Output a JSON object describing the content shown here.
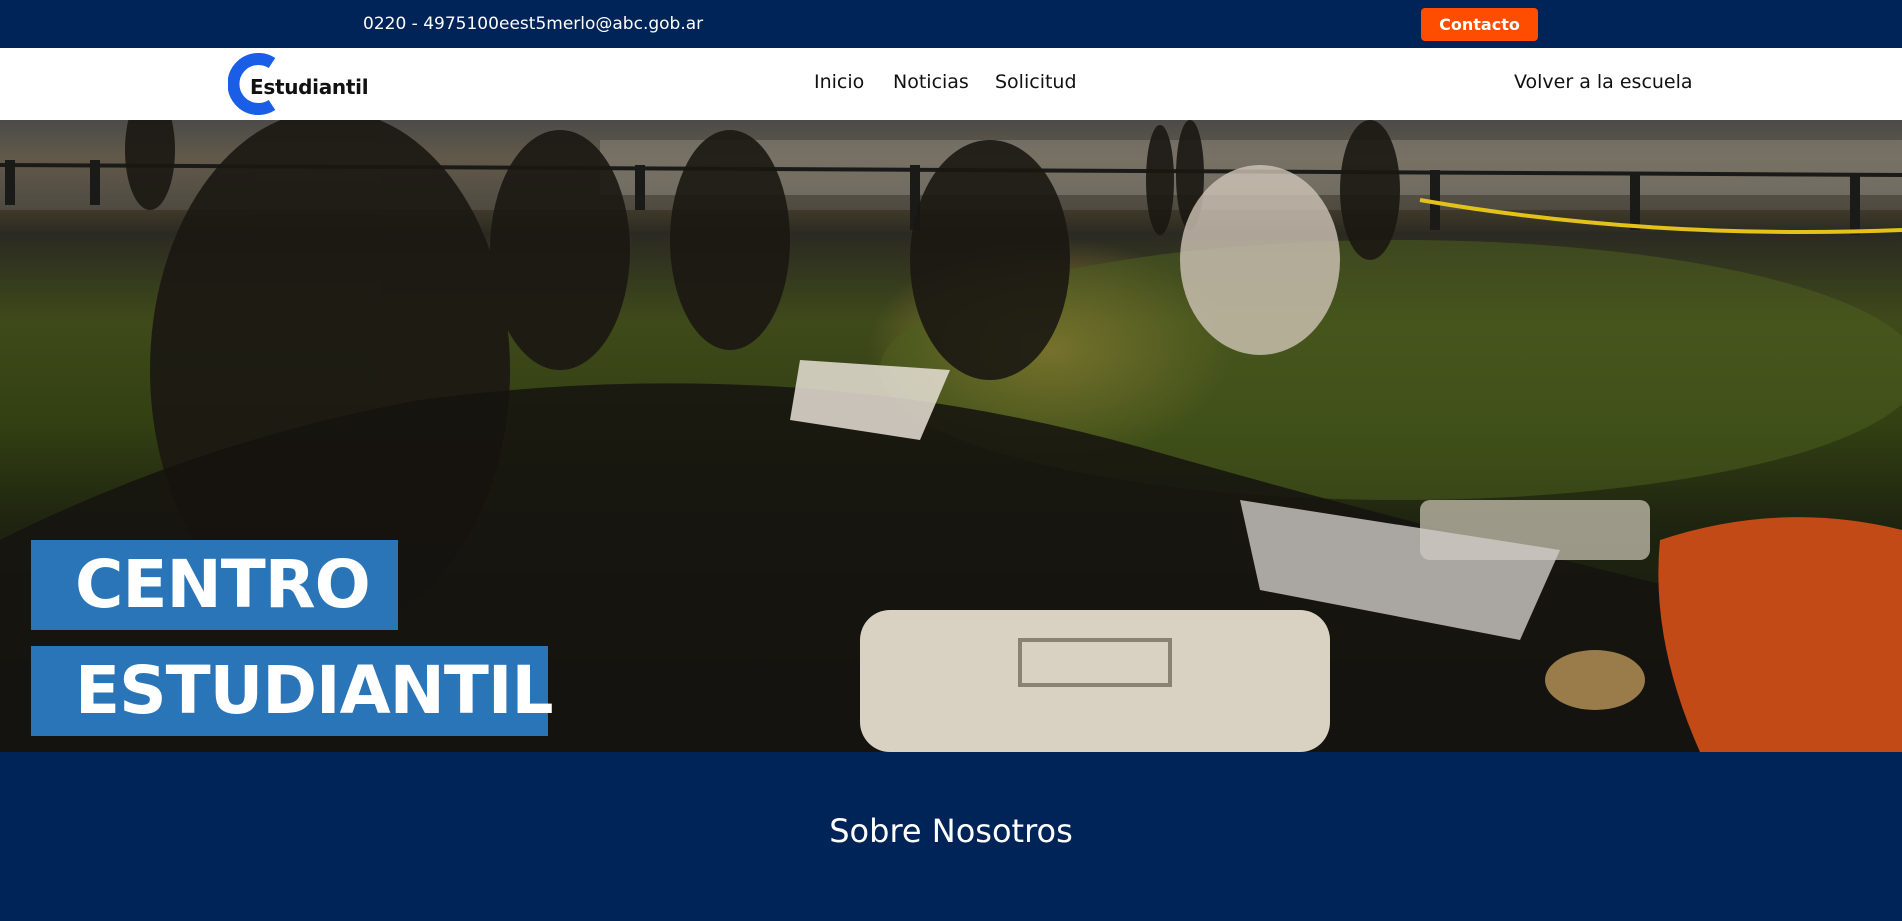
{
  "topbar": {
    "phone": "0220 - 4975100",
    "email": "eest5merlo@abc.gob.ar",
    "contact_label": "Contacto"
  },
  "logo": {
    "text": "Estudiantil",
    "icon": "logo-c-icon"
  },
  "nav": {
    "items": [
      "Inicio",
      "Noticias",
      "Solicitud"
    ],
    "back_label": "Volver a la escuela"
  },
  "hero": {
    "line1": "CENTRO",
    "line2": "ESTUDIANTIL",
    "image": "photo of students sitting on grass by the water at sunset"
  },
  "about": {
    "title": "Sobre Nosotros"
  },
  "colors": {
    "navy": "#002457",
    "accent_orange": "#ff4d00",
    "hero_box_blue": "#2a75b7",
    "logo_blue": "#1a5ee8"
  }
}
